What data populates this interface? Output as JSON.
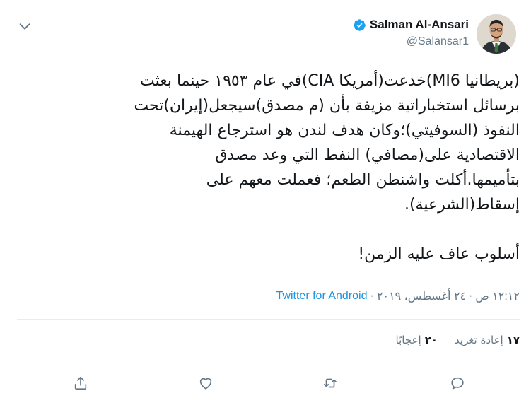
{
  "tweet": {
    "author": {
      "name": "Salman Al-Ansari",
      "handle": "@Salansar1",
      "verified": true
    },
    "text": "(بريطانيا MI6)خدعت(أمريكا CIA)في عام ١٩٥٣ حينما بعثت\nبرسائل استخباراتية مزيفة بأن (م مصدق)سيجعل(إيران)تحت\nالنفوذ (السوفيتي)؛وكان هدف لندن هو استرجاع الهيمنة\nالاقتصادية على(مصافي) النفط التي وعد مصدق\nبتأميمها.أكلت واشنطن الطعم؛ فعملت معهم على\nإسقاط(الشرعية).\n\nأسلوب عاف عليه الزمن!",
    "time": "١٢:١٢ ص",
    "date": "٢٤ أغسطس، ٢٠١٩",
    "separator": "·",
    "source": "Twitter for Android",
    "stats": {
      "retweets_count": "١٧",
      "retweets_label": "إعادة تغريد",
      "likes_count": "٢٠",
      "likes_label": "إعجابًا"
    }
  },
  "colors": {
    "accent": "#1b95e0",
    "secondary_text": "#657786",
    "primary_text": "#14171a",
    "divider": "#e6ecf0"
  },
  "icons": {
    "menu": "chevron-down-icon",
    "verified": "verified-badge-icon",
    "reply": "reply-icon",
    "retweet": "retweet-icon",
    "like": "heart-icon",
    "share": "share-icon"
  }
}
